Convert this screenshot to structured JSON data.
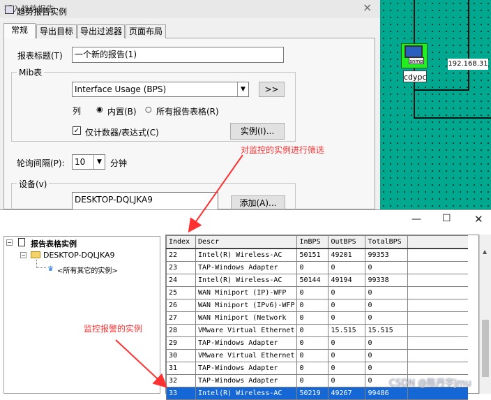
{
  "back_dialog": {
    "title": "插入趋势报告",
    "close_glyph": "×",
    "tabs": [
      "常规",
      "导出目标",
      "导出过滤器",
      "页面布局"
    ],
    "report_title_label": "报表标题(T)",
    "report_title_value": "一个新的报告(1)",
    "mib_group_label": "Mib表",
    "mib_value": "Interface Usage (BPS)",
    "mib_button": ">>",
    "column_label": "列",
    "radio_builtin": "内置(B)",
    "radio_all_tables": "所有报告表格(R)",
    "counters_only_label": "仅计数器/表达式(C)",
    "instances_button": "实例(I)...",
    "poll_interval_label": "轮询间隔(P):",
    "poll_interval_value": "10",
    "poll_unit": "分钟",
    "device_group_label": "设备(v)",
    "device_item": "DESKTOP-DQLJKA9",
    "add_button": "添加(A)..."
  },
  "network_map": {
    "node_label": "cdypc",
    "node_badge": "snmp",
    "ip_label": "192.168.31"
  },
  "instances_window": {
    "title": "趋势报告实例",
    "tree": {
      "root": "报告表格实例",
      "host": "DESKTOP-DQLJKA9",
      "other": "<所有其它的实例>"
    },
    "columns": [
      "Index",
      "Descr",
      "InBPS",
      "OutBPS",
      "TotalBPS"
    ],
    "rows": [
      [
        "22",
        "Intel(R) Wireless-AC",
        "50151",
        "49201",
        "99353"
      ],
      [
        "23",
        "TAP-Windows Adapter",
        "0",
        "0",
        "0"
      ],
      [
        "24",
        "Intel(R) Wireless-AC",
        "50144",
        "49194",
        "99338"
      ],
      [
        "25",
        "WAN Miniport (IP)-WFP",
        "0",
        "0",
        "0"
      ],
      [
        "26",
        "WAN Miniport (IPv6)-WFP",
        "0",
        "0",
        "0"
      ],
      [
        "27",
        "WAN Miniport (Network",
        "0",
        "0",
        "0"
      ],
      [
        "28",
        "VMware Virtual Ethernet",
        "0",
        "15.515",
        "15.515"
      ],
      [
        "29",
        "TAP-Windows Adapter",
        "0",
        "0",
        "0"
      ],
      [
        "30",
        "VMware Virtual Ethernet",
        "0",
        "0",
        "0"
      ],
      [
        "31",
        "TAP-Windows Adapter",
        "0",
        "0",
        "0"
      ],
      [
        "32",
        "TAP-Windows Adapter",
        "0",
        "0",
        "0"
      ],
      [
        "33",
        "Intel(R) Wireless-AC",
        "50219",
        "49267",
        "99486"
      ]
    ],
    "selected_index": "33"
  },
  "annotations": {
    "filter_note": "对监控的实例进行筛选",
    "alarm_note": "监控报警的实例"
  },
  "watermark": "CSDN @陈丹宇jmu",
  "colors": {
    "map_bg": "#00a88f",
    "node_green": "#22ee22",
    "selection_blue": "#1467d4",
    "annotation_red": "#ff3030"
  }
}
